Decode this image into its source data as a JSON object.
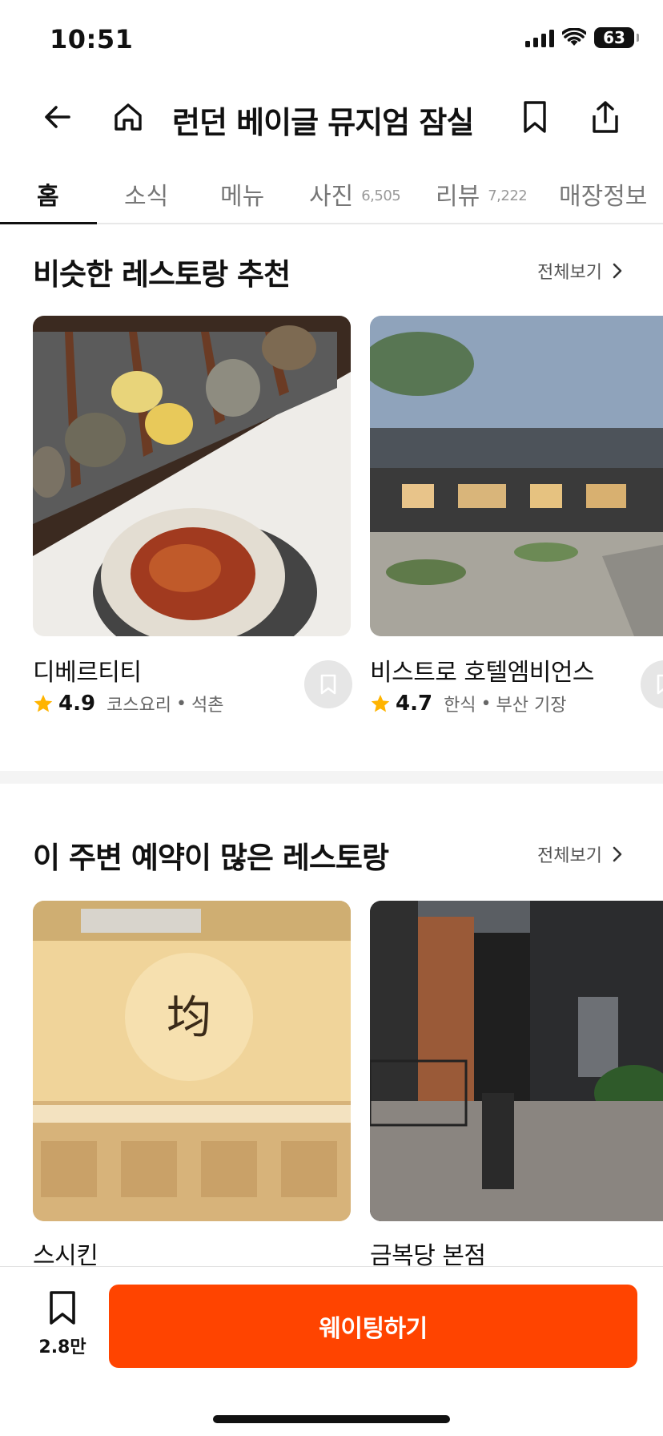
{
  "status": {
    "time": "10:51",
    "battery": "63"
  },
  "header": {
    "title": "런던 베이글 뮤지엄 잠실"
  },
  "tabs": [
    {
      "label": "홈",
      "count": ""
    },
    {
      "label": "소식",
      "count": ""
    },
    {
      "label": "메뉴",
      "count": ""
    },
    {
      "label": "사진",
      "count": "6,505"
    },
    {
      "label": "리뷰",
      "count": "7,222"
    },
    {
      "label": "매장정보",
      "count": ""
    }
  ],
  "similar": {
    "title": "비슷한 레스토랑 추천",
    "see_all": "전체보기",
    "cards": [
      {
        "name": "디베르티티",
        "rating": "4.9",
        "category": "코스요리",
        "location": "석촌"
      },
      {
        "name": "비스트로 호텔엠비언스",
        "rating": "4.7",
        "category": "한식",
        "location": "부산 기장"
      }
    ]
  },
  "popular": {
    "title": "이 주변 예약이 많은 레스토랑",
    "see_all": "전체보기",
    "cards": [
      {
        "name": "스시킨"
      },
      {
        "name": "금복당 본점"
      }
    ]
  },
  "bottom": {
    "save_count": "2.8만",
    "wait_label": "웨이팅하기"
  },
  "colors": {
    "accent": "#ff4400",
    "star": "#ffb400"
  },
  "icons": [
    "back-arrow-icon",
    "home-icon",
    "bookmark-icon",
    "share-icon",
    "chevron-right-icon",
    "star-icon"
  ]
}
